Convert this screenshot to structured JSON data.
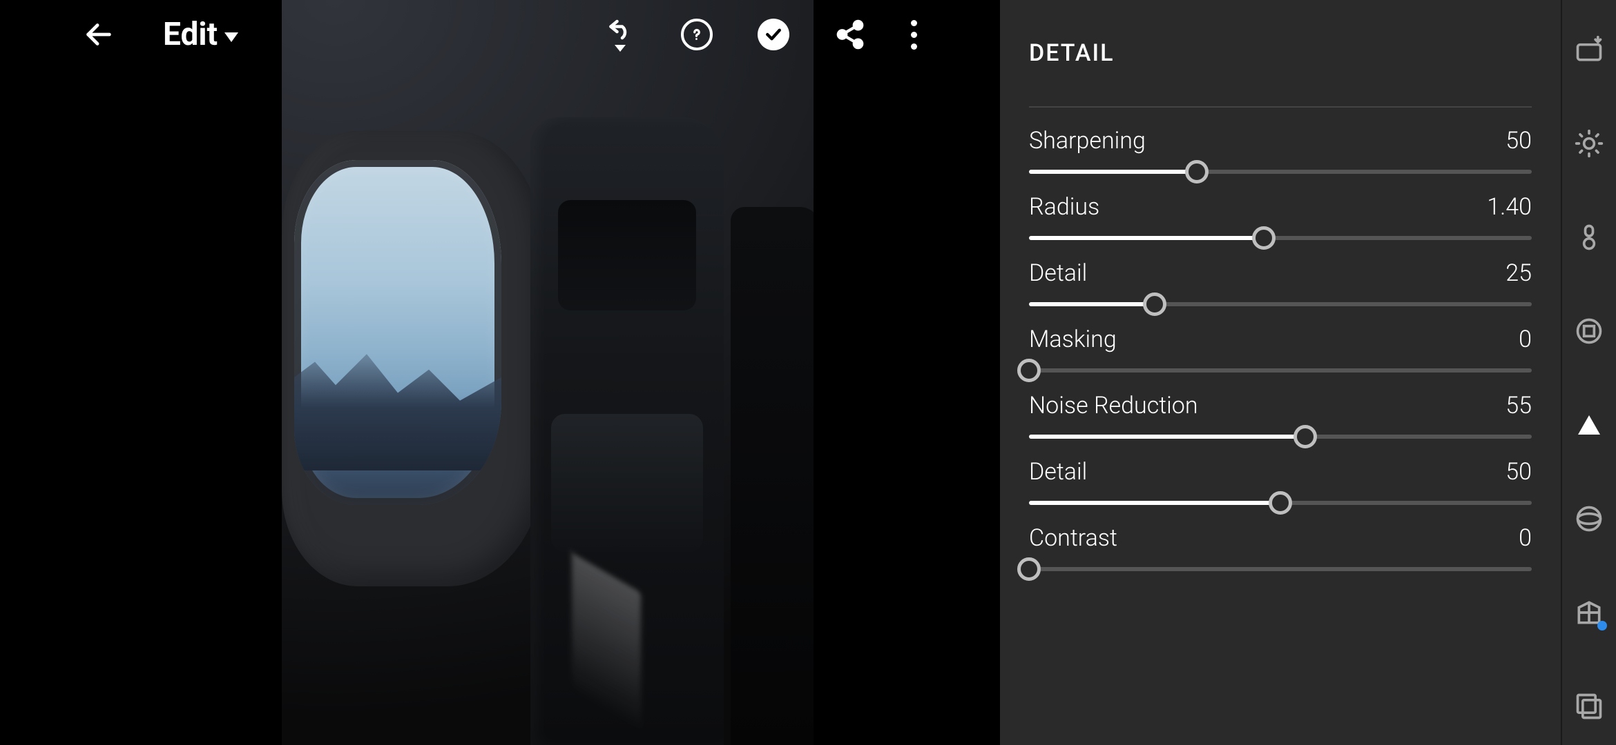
{
  "header": {
    "title": "Edit"
  },
  "panel": {
    "title": "DETAIL",
    "sliders": [
      {
        "label": "Sharpening",
        "value": "50",
        "min": 0,
        "max": 150,
        "current": 50
      },
      {
        "label": "Radius",
        "value": "1.40",
        "min": 0,
        "max": 3,
        "current": 1.4
      },
      {
        "label": "Detail",
        "value": "25",
        "min": 0,
        "max": 100,
        "current": 25
      },
      {
        "label": "Masking",
        "value": "0",
        "min": 0,
        "max": 100,
        "current": 0
      },
      {
        "label": "Noise Reduction",
        "value": "55",
        "min": 0,
        "max": 100,
        "current": 55
      },
      {
        "label": "Detail",
        "value": "50",
        "min": 0,
        "max": 100,
        "current": 50
      },
      {
        "label": "Contrast",
        "value": "0",
        "min": 0,
        "max": 100,
        "current": 0
      }
    ]
  },
  "toolrail": [
    {
      "name": "auto-icon"
    },
    {
      "name": "light-icon"
    },
    {
      "name": "color-icon"
    },
    {
      "name": "effects-icon"
    },
    {
      "name": "detail-icon",
      "active": true
    },
    {
      "name": "optics-icon"
    },
    {
      "name": "geometry-icon",
      "badge": true
    },
    {
      "name": "versions-icon"
    }
  ],
  "colors": {
    "panel_bg": "#2a2a2a",
    "track": "#555555",
    "fill": "#ffffff"
  }
}
